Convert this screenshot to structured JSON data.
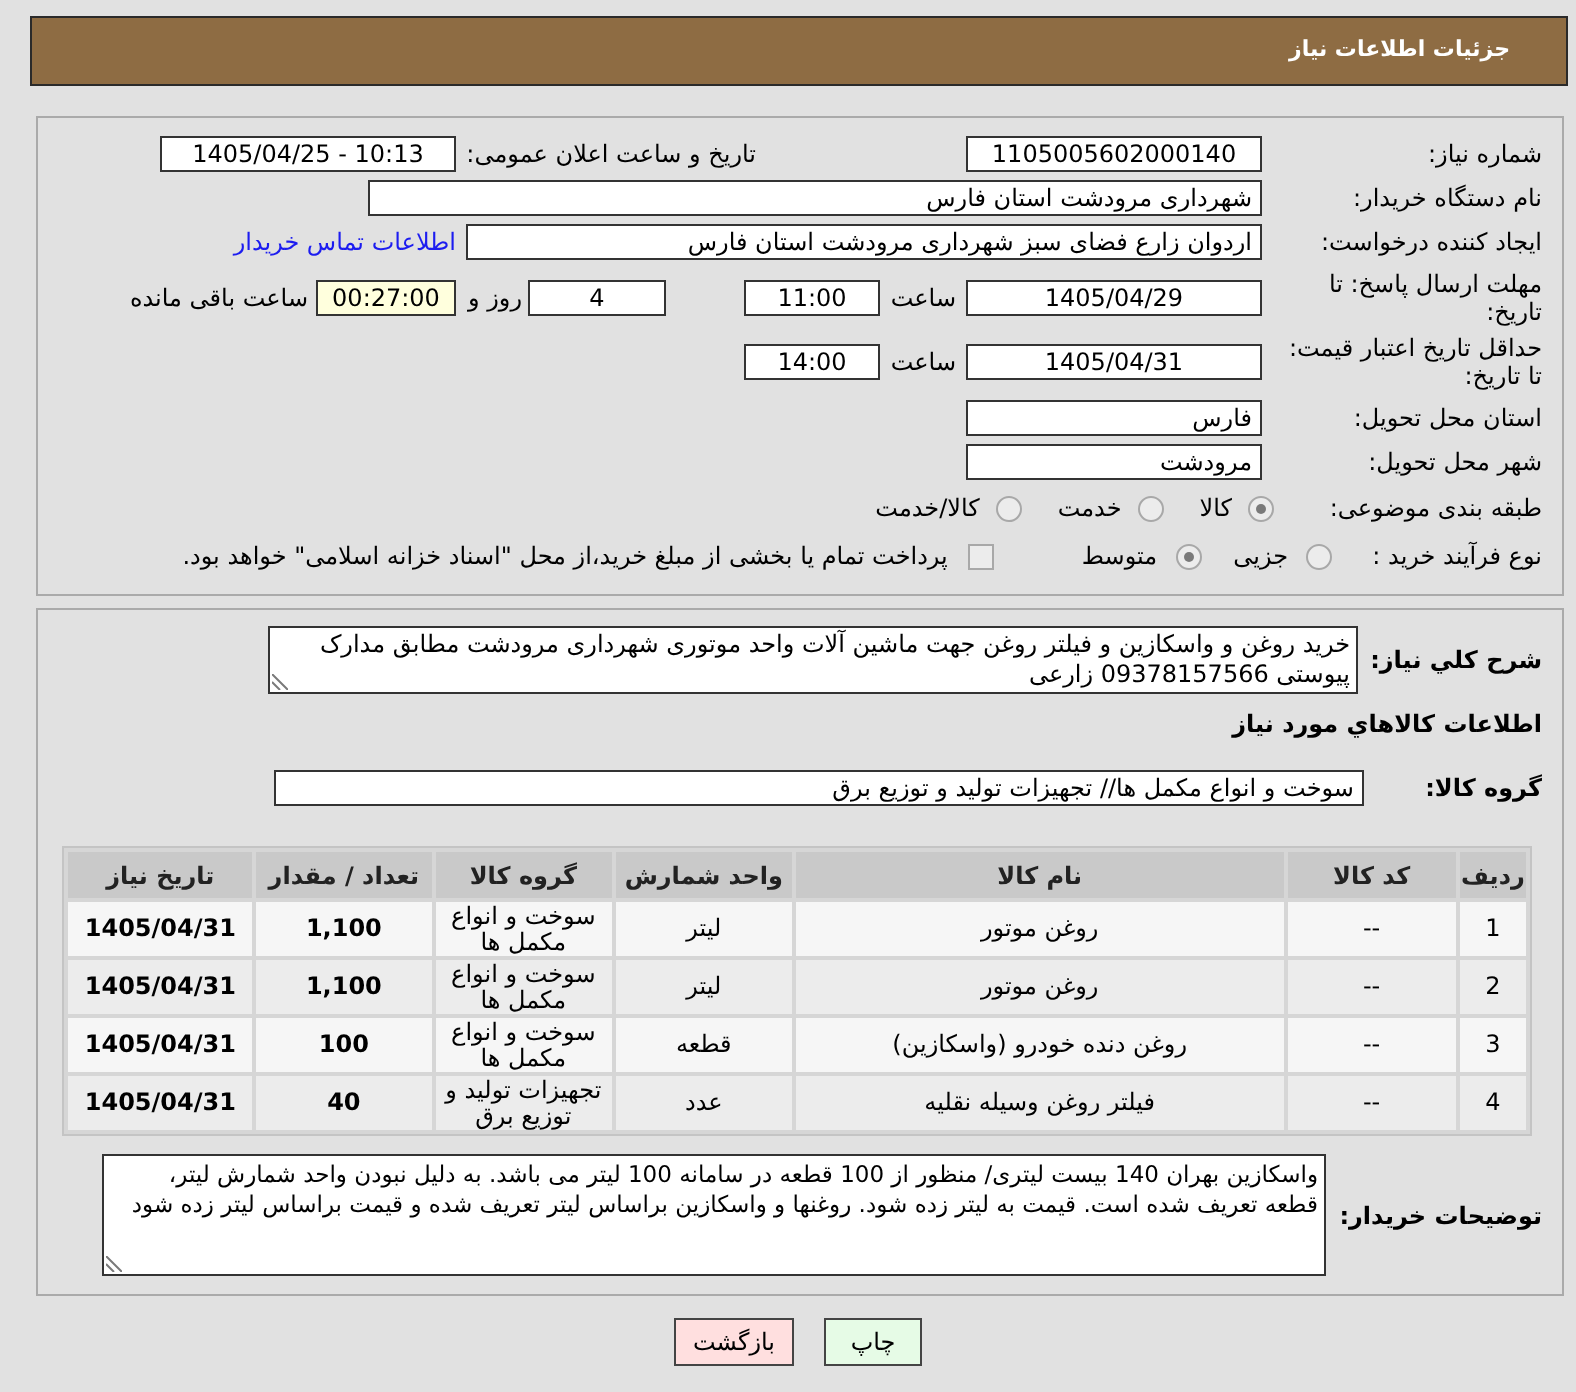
{
  "header": {
    "title": "جزئیات اطلاعات نیاز"
  },
  "summary": {
    "need_number": {
      "label": "شماره نیاز:",
      "value": "1105005602000140"
    },
    "announcement": {
      "label": "تاریخ و ساعت اعلان عمومی:",
      "value": "1405/04/25 - 10:13"
    },
    "buyer": {
      "label": "نام دستگاه خریدار:",
      "value": "شهرداری مرودشت استان فارس"
    },
    "requester": {
      "label": "ایجاد کننده درخواست:",
      "value": "اردوان زارع فضای سبز شهرداری مرودشت استان فارس",
      "contact_link": "اطلاعات تماس خریدار"
    },
    "response_deadline": {
      "label": "مهلت ارسال پاسخ: تا تاریخ:",
      "date": "1405/04/29",
      "time_label": "ساعت",
      "time": "11:00",
      "days": "4",
      "days_label": "روز و",
      "remaining": "00:27:00",
      "remaining_label": "ساعت باقی مانده"
    },
    "price_validity": {
      "label": "حداقل تاریخ اعتبار قیمت: تا تاریخ:",
      "date": "1405/04/31",
      "time_label": "ساعت",
      "time": "14:00"
    },
    "delivery_province": {
      "label": "استان محل تحویل:",
      "value": "فارس"
    },
    "delivery_city": {
      "label": "شهر محل تحویل:",
      "value": "مرودشت"
    },
    "category": {
      "label": "طبقه بندی موضوعی:",
      "options": [
        {
          "label": "کالا",
          "selected": true
        },
        {
          "label": "خدمت",
          "selected": false
        },
        {
          "label": "کالا/خدمت",
          "selected": false
        }
      ]
    },
    "purchase_process": {
      "label": "نوع فرآیند خرید :",
      "options": [
        {
          "label": "جزیی",
          "selected": false
        },
        {
          "label": "متوسط",
          "selected": true
        }
      ],
      "treasury_payment": {
        "label": "پرداخت تمام یا بخشی از مبلغ خرید،از محل \"اسناد خزانه اسلامی\" خواهد بود.",
        "checked": false
      }
    }
  },
  "details": {
    "description": {
      "label": "شرح کلي نياز:",
      "value": "خرید روغن و واسکازین و فیلتر روغن جهت ماشین آلات واحد موتوری شهرداری مرودشت مطابق مدارک پیوستی 09378157566 زارعی"
    },
    "goods_title": "اطلاعات کالاهاي مورد نياز",
    "goods_group": {
      "label": "گروه کالا:",
      "value": "سوخت و انواع مکمل ها// تجهیزات تولید و توزیع برق"
    },
    "table": {
      "columns": [
        "ردیف",
        "کد کالا",
        "نام کالا",
        "واحد شمارش",
        "گروه کالا",
        "تعداد / مقدار",
        "تاریخ نیاز"
      ],
      "rows": [
        [
          "1",
          "--",
          "روغن موتور",
          "لیتر",
          "سوخت و انواع مکمل ها",
          "1,100",
          "1405/04/31"
        ],
        [
          "2",
          "--",
          "روغن موتور",
          "لیتر",
          "سوخت و انواع مکمل ها",
          "1,100",
          "1405/04/31"
        ],
        [
          "3",
          "--",
          "روغن دنده خودرو (واسکازین)",
          "قطعه",
          "سوخت و انواع مکمل ها",
          "100",
          "1405/04/31"
        ],
        [
          "4",
          "--",
          "فیلتر روغن وسیله نقلیه",
          "عدد",
          "تجهیزات تولید و توزیع برق",
          "40",
          "1405/04/31"
        ]
      ]
    },
    "buyer_notes": {
      "label": "توضیحات خریدار:",
      "value": "واسکازین بهران 140 بیست لیتری/ منظور از 100 قطعه در سامانه 100 لیتر می باشد. به دلیل نبودن واحد شمارش لیتر، قطعه تعریف شده است. قیمت به لیتر زده شود. روغنها و واسکازین براساس لیتر تعریف شده و قیمت براساس لیتر زده شود"
    }
  },
  "buttons": [
    {
      "kind": "print",
      "label": "چاپ"
    },
    {
      "kind": "back",
      "label": "بازگشت"
    }
  ]
}
